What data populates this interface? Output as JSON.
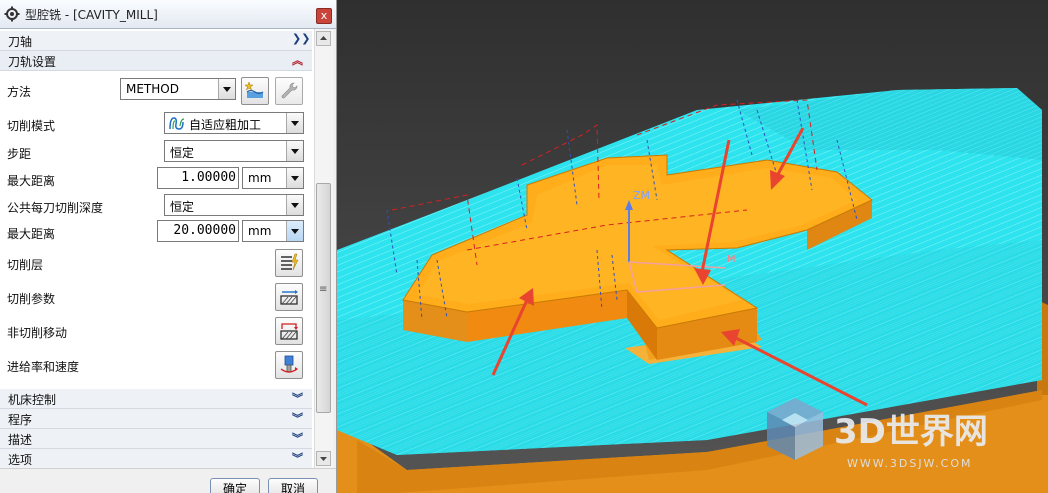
{
  "dialog": {
    "title": "型腔铣 - [CAVITY_MILL]",
    "close_label": "x",
    "groups": {
      "tool_axis": "刀轴",
      "path_settings": "刀轨设置",
      "machine_control": "机床控制",
      "program": "程序",
      "description": "描述",
      "options": "选项"
    },
    "fields": {
      "method_label": "方法",
      "method_value": "METHOD",
      "cut_pattern_label": "切削模式",
      "cut_pattern_value": "自适应粗加工",
      "stepover_label": "步距",
      "stepover_value": "恒定",
      "max_distance_label": "最大距离",
      "max_distance_value": "1.00000",
      "max_distance_unit": "mm",
      "common_depth_label": "公共每刀切削深度",
      "common_depth_value": "恒定",
      "max_distance2_label": "最大距离",
      "max_distance2_value": "20.00000",
      "max_distance2_unit": "mm"
    },
    "actions": {
      "cut_levels": "切削层",
      "cut_parameters": "切削参数",
      "non_cut_moves": "非切削移动",
      "feeds_speeds": "进给率和速度"
    },
    "buttons": {
      "ok": "确定",
      "cancel": "取消"
    },
    "scroll_mid_glyph": "≡"
  },
  "viewport": {
    "axis_label": "ZM",
    "axis_label_small": "M",
    "watermark_brand": "3D世界网",
    "watermark_url": "WWW.3DSJW.COM"
  },
  "colors": {
    "part": "#f5a623",
    "toolpath": "#2ee6f0",
    "arrow": "#e8442f",
    "background": "#3a3a3a"
  }
}
